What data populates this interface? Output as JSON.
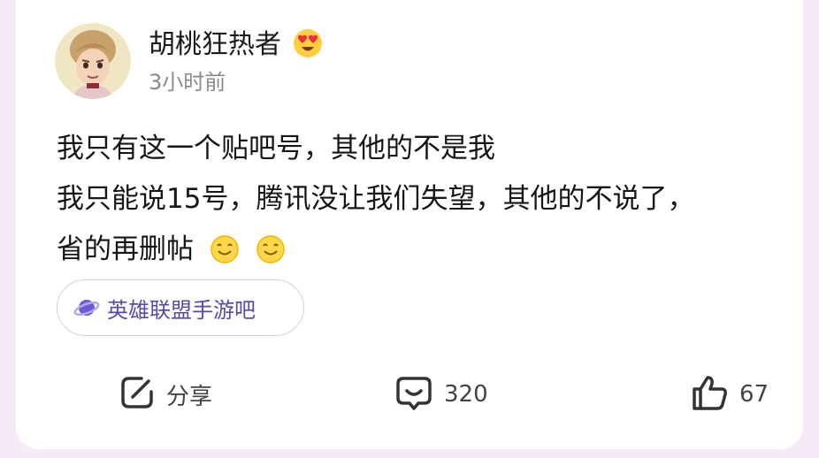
{
  "post": {
    "username": "胡桃狂热者",
    "username_emoji": "heart-eyes-emoji",
    "time": "3小时前",
    "lines": [
      "我只有这一个贴吧号，其他的不是我",
      "我只能说15号，腾讯没让我们失望，其他的不说了，",
      "省的再删帖"
    ],
    "inline_emojis": [
      "smile-emoji",
      "smile-emoji"
    ]
  },
  "forum": {
    "name": "英雄联盟手游吧",
    "icon": "planet-icon"
  },
  "actions": {
    "share_label": "分享",
    "comment_count": "320",
    "like_count": "67"
  },
  "colors": {
    "background": "#f7eaf7",
    "card": "#ffffff",
    "forum_text": "#5a4aa8",
    "forum_border": "#d9cbe8",
    "muted": "#8a8a8a"
  }
}
